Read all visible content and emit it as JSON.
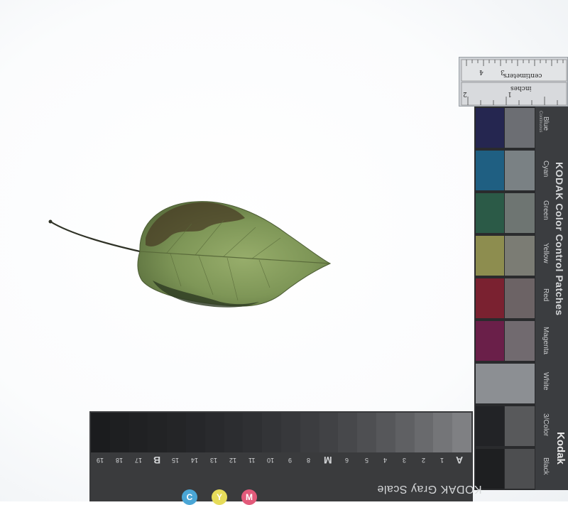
{
  "ruler": {
    "unit_inches": "inches",
    "unit_cm": "centimeters",
    "numbers": [
      "1",
      "2",
      "3",
      "4"
    ]
  },
  "color_chart": {
    "title": "KODAK Color Control Patches",
    "subtitle": "Continuous",
    "logo": "Kodak",
    "patch_names": [
      "Blue",
      "Cyan",
      "Green",
      "Yellow",
      "Red",
      "Magenta",
      "White",
      "3/Color",
      "Black"
    ],
    "colors": {
      "blue": "#252650",
      "cyan": "#1f5f82",
      "green": "#2b5a47",
      "yellow": "#8d8d4f",
      "red": "#7a2130",
      "magenta": "#6a1f49",
      "white": "#8c8f93",
      "three_color": "#222326",
      "black": "#1e1f21"
    }
  },
  "gray_scale": {
    "title": "KODAK Gray Scale",
    "numbers": [
      "A",
      "1",
      "2",
      "3",
      "4",
      "5",
      "6",
      "M",
      "8",
      "9",
      "10",
      "11",
      "12",
      "13",
      "14",
      "15",
      "B",
      "17",
      "18",
      "19"
    ],
    "dot_labels": [
      "C",
      "Y",
      "M"
    ]
  },
  "subject": {
    "leaf_color": "#6f8a4c",
    "leaf_dark": "#3c3a22"
  }
}
